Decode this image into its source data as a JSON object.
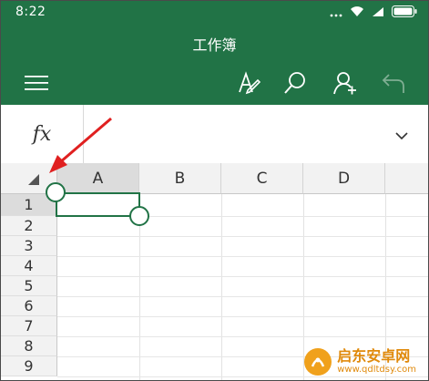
{
  "status_bar": {
    "time": "8:22"
  },
  "app": {
    "title": "工作簿",
    "brand_color": "#217346"
  },
  "toolbar": {
    "icons": [
      "menu-icon",
      "pen-format-icon",
      "search-icon",
      "share-person-icon",
      "undo-icon"
    ]
  },
  "formula_bar": {
    "fx_label": "fx",
    "value": ""
  },
  "sheet": {
    "columns": [
      "A",
      "B",
      "C",
      "D"
    ],
    "rows": [
      "1",
      "2",
      "3",
      "4",
      "5",
      "6",
      "7",
      "8",
      "9"
    ],
    "selected_cell": "A1"
  },
  "watermark": {
    "text": "启东安卓网",
    "url": "www.qdltdsy.com"
  }
}
